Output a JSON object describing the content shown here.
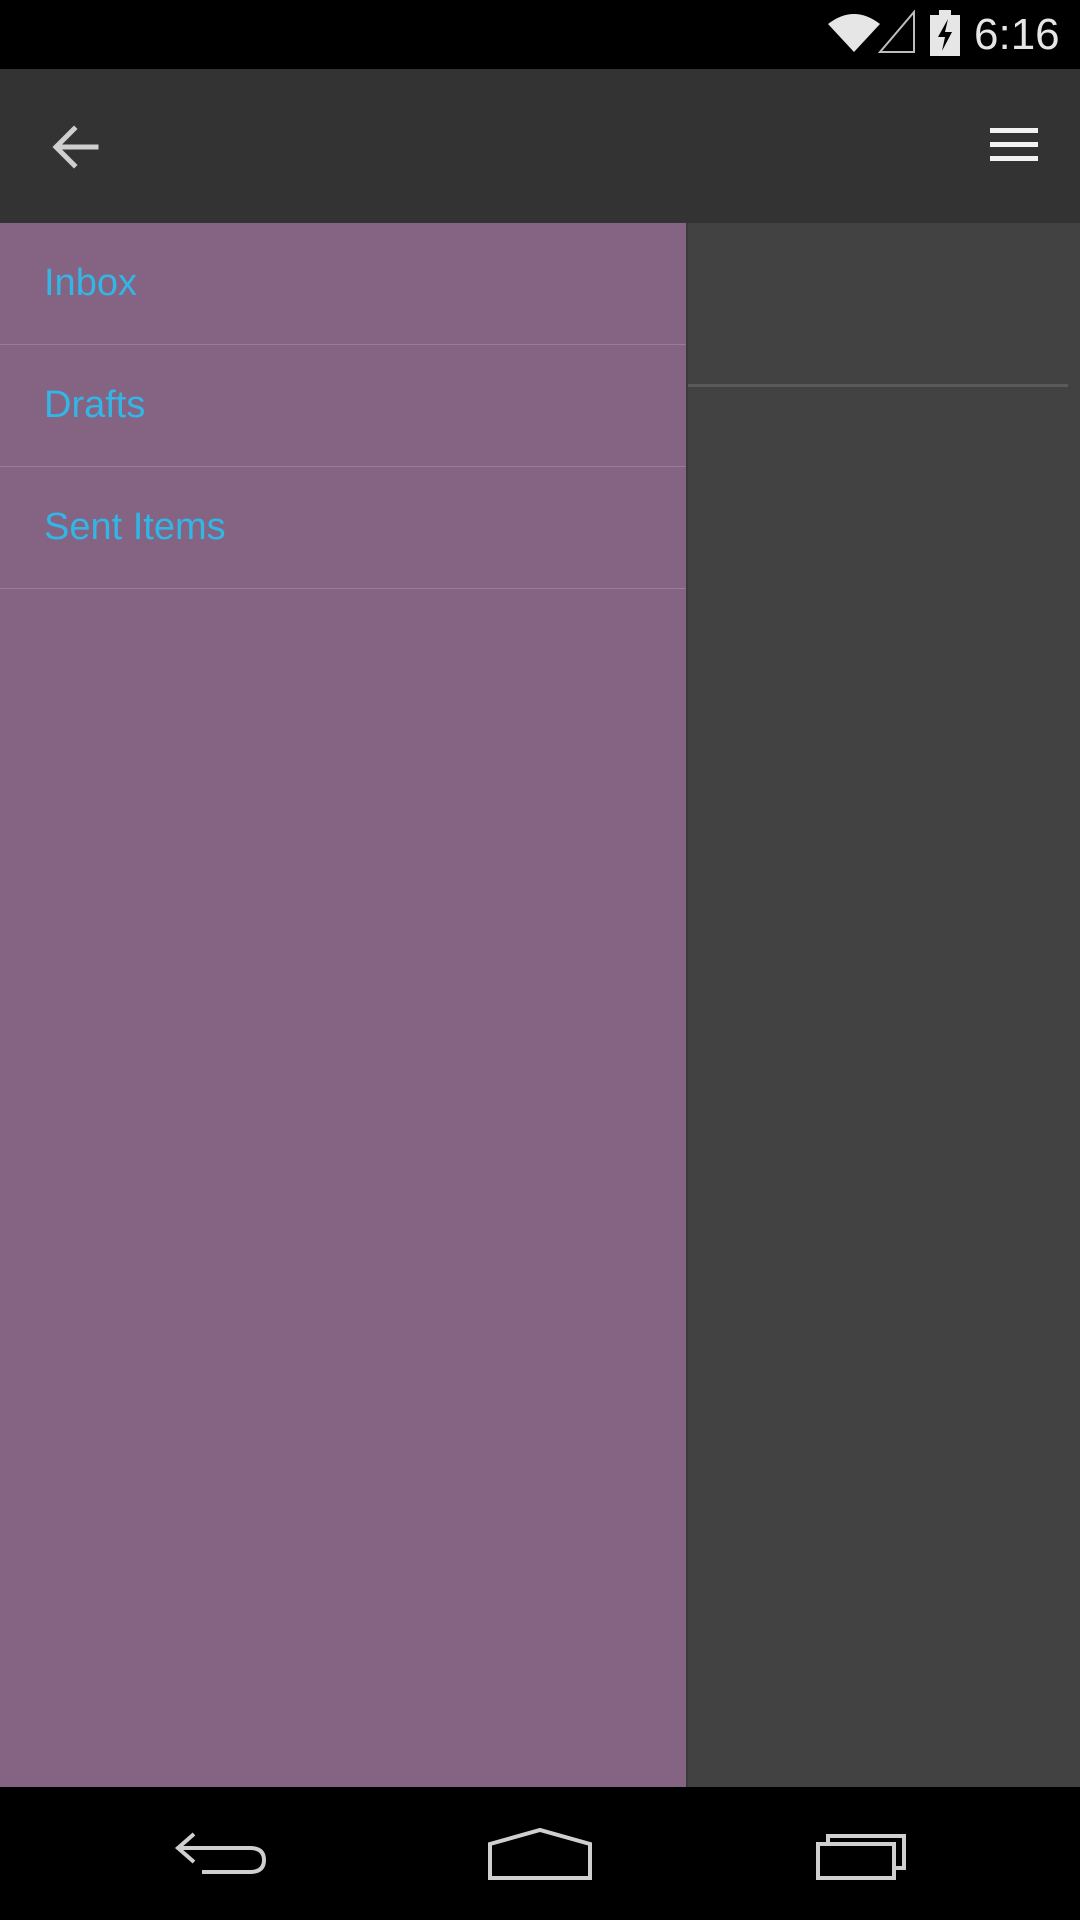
{
  "status_bar": {
    "time": "6:16",
    "icons": [
      "wifi-icon",
      "cell-signal-icon",
      "battery-charging-icon"
    ]
  },
  "action_bar": {
    "back_icon": "arrow-left-icon",
    "menu_icon": "hamburger-menu-icon"
  },
  "drawer": {
    "background_color": "#846383",
    "label_color": "#33b5e5",
    "items": [
      {
        "label": "Inbox"
      },
      {
        "label": "Drafts"
      },
      {
        "label": "Sent Items"
      }
    ]
  },
  "nav_bar": {
    "icons": [
      "nav-back-icon",
      "nav-home-icon",
      "nav-recents-icon"
    ]
  }
}
